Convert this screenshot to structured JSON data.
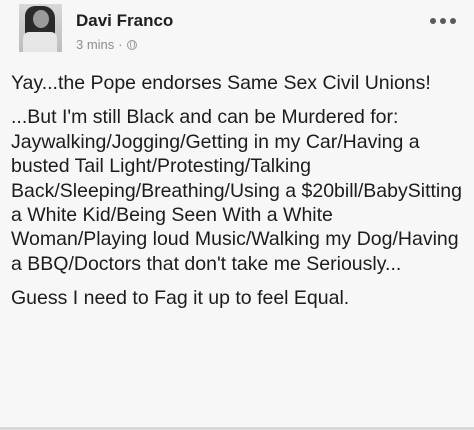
{
  "post": {
    "author_name": "Davi Franco",
    "timestamp": "3 mins",
    "separator": "·",
    "privacy_icon": "globe-icon",
    "more_icon": "more-dots-icon",
    "paragraphs": [
      "Yay...the Pope endorses Same Sex Civil Unions!",
      "...But I'm still Black and can be Murdered for: Jaywalking/Jogging/Getting in my Car/Having a busted Tail Light/Protesting/Talking Back/Sleeping/Breathing/Using a $20bill/BabySitting a White Kid/Being Seen With a White Woman/Playing loud Music/Walking my Dog/Having a BBQ/Doctors that don't take me Seriously...",
      "Guess I need to Fag it up to feel Equal."
    ]
  },
  "colors": {
    "background": "#f7f7f7",
    "text": "#1c1c1c",
    "meta_text": "#8e8e8e"
  }
}
